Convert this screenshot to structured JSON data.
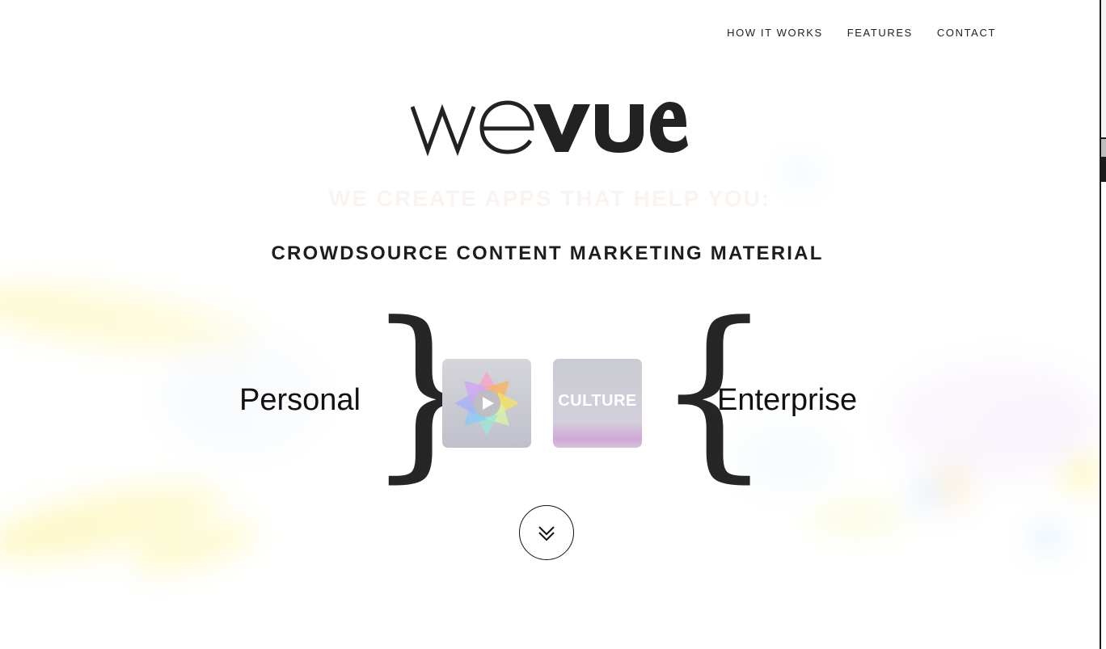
{
  "nav": {
    "items": [
      "HOW IT WORKS",
      "FEATURES",
      "CONTACT"
    ]
  },
  "brand": {
    "logo_text": "wevue"
  },
  "hero": {
    "ghost_heading": "WE CREATE APPS THAT HELP YOU:",
    "headline": "CROWDSOURCE CONTENT MARKETING MATERIAL",
    "left_label": "Personal",
    "right_label": "Enterprise",
    "culture_tile_text": "CULTURE"
  },
  "icons": {
    "scroll_down": "double-chevron-down-icon",
    "play": "play-icon"
  },
  "colors": {
    "text": "#1f1f1f",
    "background": "#ffffff",
    "accent_yellow": "#f5e61e"
  }
}
